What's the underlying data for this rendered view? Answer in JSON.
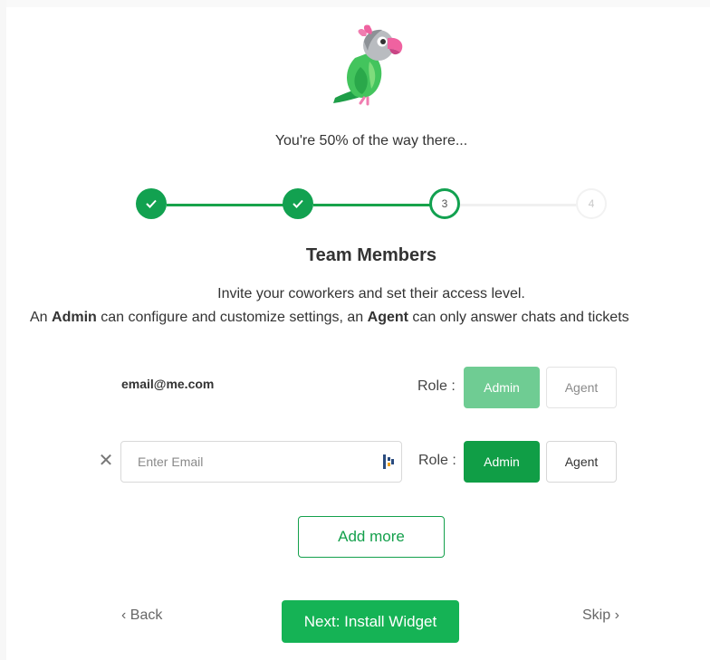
{
  "progress_text": "You're 50% of the way there...",
  "steps": [
    {
      "label": "",
      "state": "complete"
    },
    {
      "label": "",
      "state": "complete"
    },
    {
      "label": "3",
      "state": "current"
    },
    {
      "label": "4",
      "state": "upcoming"
    }
  ],
  "section_title": "Team Members",
  "description": {
    "line1": "Invite your coworkers and set their access level.",
    "line2_prefix": "An ",
    "admin_word": "Admin",
    "line2_mid": " can configure and customize settings, an ",
    "agent_word": "Agent",
    "line2_suffix": " can only answer chats and tickets"
  },
  "members": {
    "existing": {
      "email": "email@me.com",
      "role_label": "Role :",
      "admin_label": "Admin",
      "agent_label": "Agent",
      "selected_role": "Admin"
    },
    "new": {
      "email_value": "",
      "email_placeholder": "Enter Email",
      "role_label": "Role :",
      "admin_label": "Admin",
      "agent_label": "Agent",
      "selected_role": "Admin"
    }
  },
  "add_more_label": "Add more",
  "footer": {
    "back_label": "‹ Back",
    "next_label": "Next: Install Widget",
    "skip_label": "Skip ›"
  },
  "colors": {
    "primary_green": "#15b355",
    "dark_green": "#109e46",
    "disabled_green": "#6fcc93",
    "step_green": "#12a150"
  },
  "icons": {
    "mascot": "parrot-mascot-icon",
    "complete_step": "check-icon",
    "remove": "close-icon",
    "autofill": "password-manager-icon"
  }
}
